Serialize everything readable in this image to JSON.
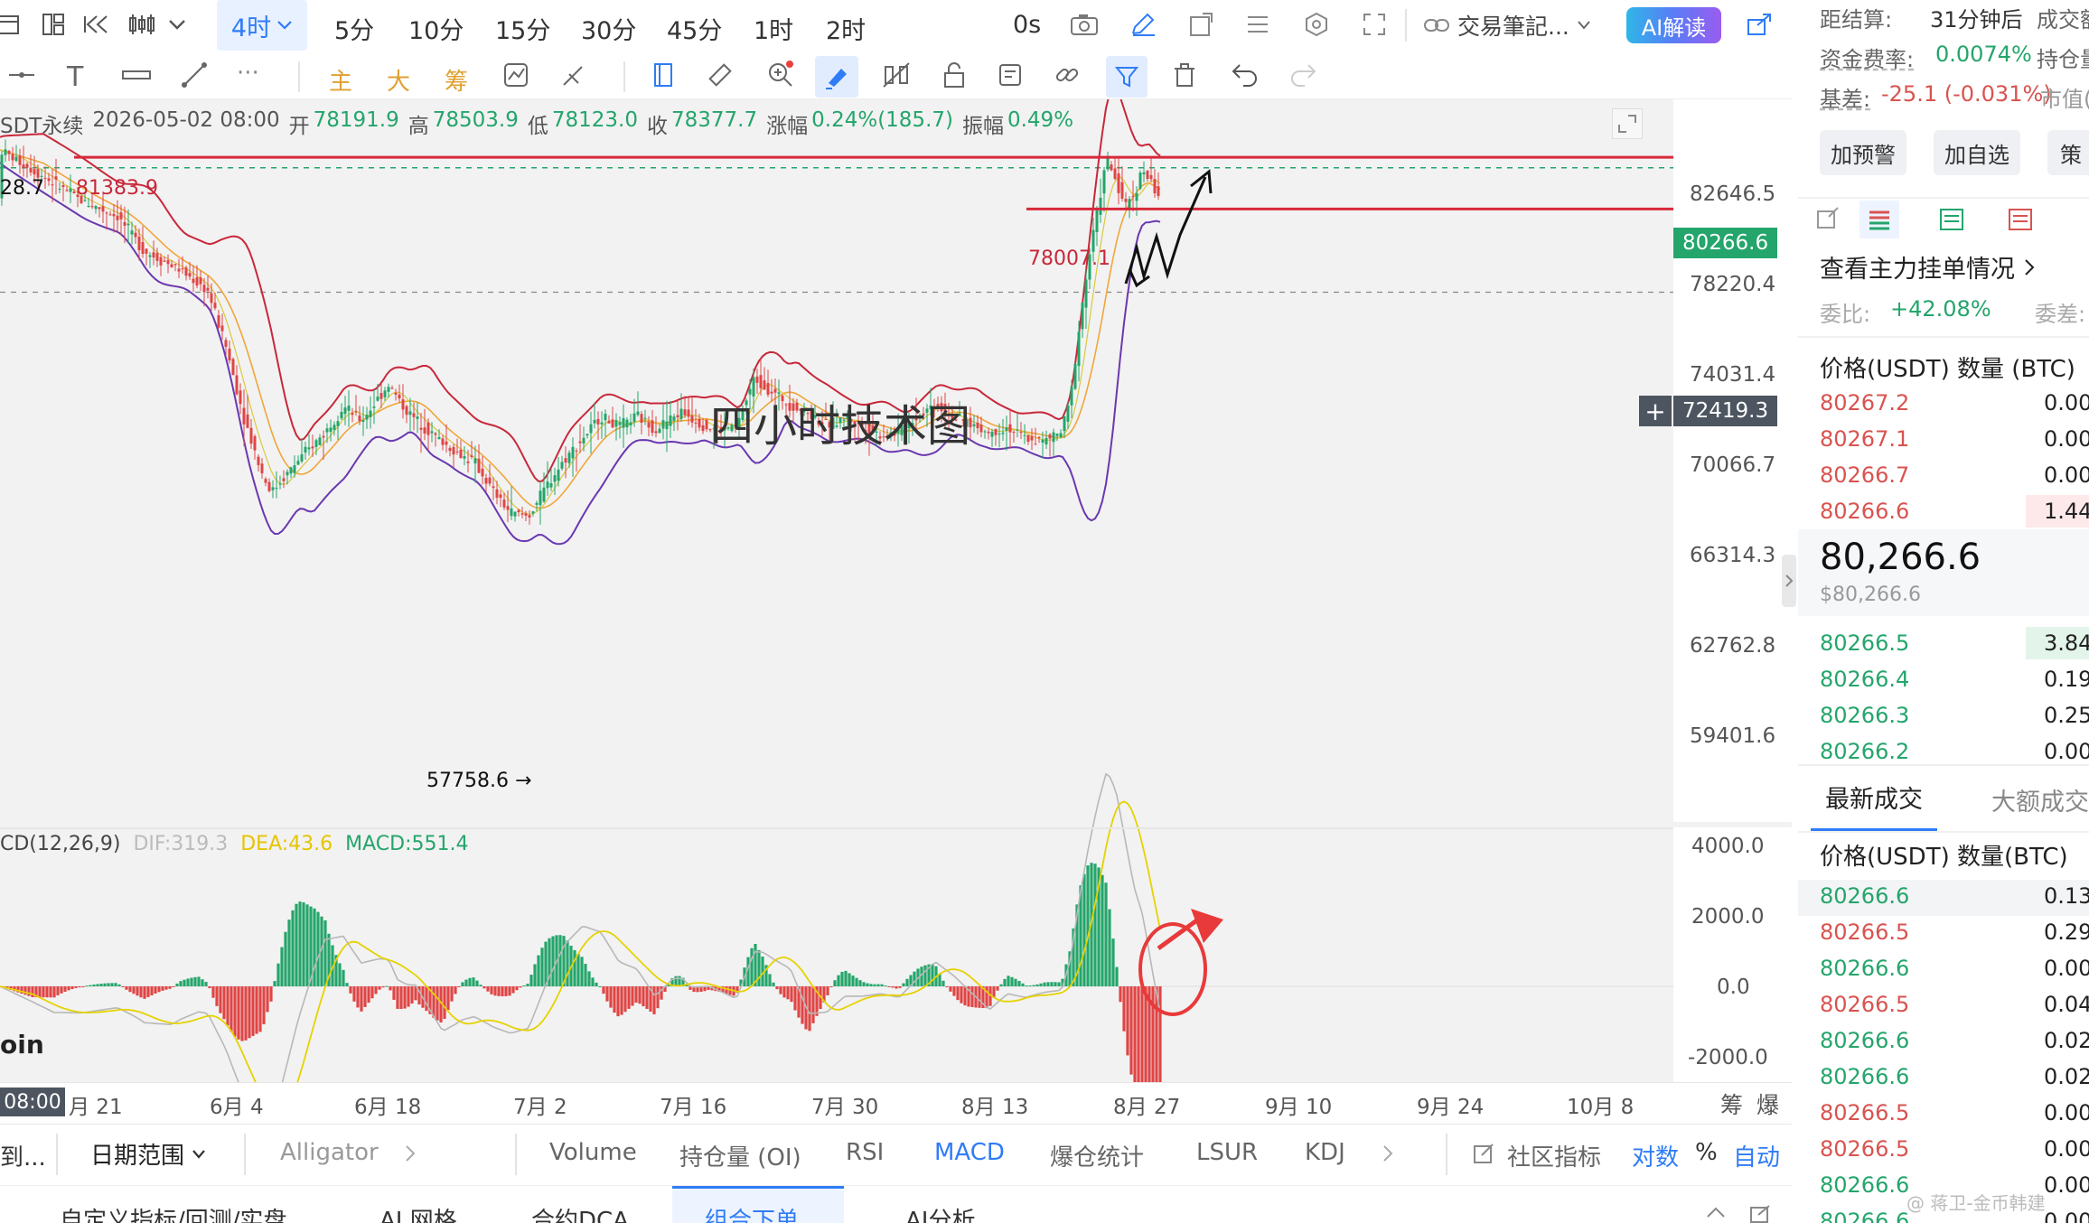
{
  "toolbar": {
    "intervals": [
      "4时",
      "5分",
      "10分",
      "15分",
      "30分",
      "45分",
      "1时",
      "2时"
    ],
    "countdown": "0s",
    "note_dropdown": "交易筆記...",
    "ai_button": "AI解读"
  },
  "drawing_toolbar": {
    "labels": [
      "主",
      "大",
      "筹"
    ]
  },
  "ohlc": {
    "symbol": "SDT永续",
    "datetime": "2026-05-02 08:00",
    "open_label": "开",
    "open": "78191.9",
    "high_label": "高",
    "high": "78503.9",
    "low_label": "低",
    "low": "78123.0",
    "close_label": "收",
    "close": "78377.7",
    "change_label": "涨幅",
    "change": "0.24%(185.7)",
    "amp_label": "振幅",
    "amp": "0.49%"
  },
  "chart": {
    "watermark": "四小时技术图",
    "left_high_label": "28.7",
    "level_high": "81383.9",
    "level_mid": "78007.1",
    "low_label": "57758.6 →",
    "price_axis": [
      "82646.5",
      "78220.4",
      "74031.4",
      "70066.7",
      "66314.3",
      "62762.8",
      "59401.6"
    ],
    "current_price": "80266.6",
    "crosshair_price": "72419.3",
    "date_axis": [
      "月 21",
      "6月 4",
      "6月 18",
      "7月 2",
      "7月 16",
      "7月 30",
      "8月 13",
      "8月 27",
      "9月 10",
      "9月 24",
      "10月 8"
    ],
    "date_cursor": "08:00",
    "axis_right_labels": [
      "筹",
      "爆"
    ],
    "brand_fragment": "oin",
    "colors": {
      "up": "#24a56b",
      "down": "#e04545",
      "level_line": "#d8283a",
      "bb_upper": "#c8283a",
      "bb_lower": "#6a38b0",
      "ma": "#f0a63a",
      "current_pill": "#24a56b",
      "cross_pill": "#4d5560"
    }
  },
  "macd": {
    "title": "CD(12,26,9)",
    "dif": "DIF:319.3",
    "dea": "DEA:43.6",
    "macd": "MACD:551.4",
    "axis": [
      "4000.0",
      "2000.0",
      "0.0",
      "-2000.0"
    ]
  },
  "indicator_bar": {
    "left_cut": "到...",
    "date_range": "日期范围",
    "alligator": "Alligator",
    "items": [
      "Volume",
      "持仓量 (OI)",
      "RSI",
      "MACD",
      "爆仓统计",
      "LSUR",
      "KDJ"
    ],
    "active": "MACD",
    "community": "社区指标",
    "log": "对数",
    "percent": "%",
    "auto": "自动"
  },
  "bottom_tabs": [
    "自定义指标/回测/实盘",
    "AI 网格",
    "合约DCA",
    "组合下单",
    "AI分析"
  ],
  "bottom_active": "组合下单",
  "right": {
    "settle_label": "距结算:",
    "settle_value": "31分钟后",
    "volume_label": "成交额",
    "funding_label": "资金费率:",
    "funding_value": "0.0074%",
    "oi_label": "持仓量",
    "basis_label": "基差:",
    "basis_value": "-25.1 (-0.031%)",
    "mkt_label": "市值(",
    "btn_alert": "加预警",
    "btn_fav": "加自选",
    "btn_more": "策",
    "main_orders": "查看主力挂单情况",
    "ratio_label": "委比:",
    "ratio_value": "+42.08%",
    "diff_label": "委差:",
    "ob_header": "价格(USDT) 数量 (BTC)",
    "asks": [
      {
        "price": "80267.2",
        "qty": "0.00"
      },
      {
        "price": "80267.1",
        "qty": "0.00"
      },
      {
        "price": "80266.7",
        "qty": "0.00"
      },
      {
        "price": "80266.6",
        "qty": "1.44"
      }
    ],
    "last_price": "80,266.6",
    "last_price_usd": "$80,266.6",
    "bids": [
      {
        "price": "80266.5",
        "qty": "3.84"
      },
      {
        "price": "80266.4",
        "qty": "0.19"
      },
      {
        "price": "80266.3",
        "qty": "0.25"
      },
      {
        "price": "80266.2",
        "qty": "0.00"
      }
    ],
    "trades_tab": "最新成交",
    "big_trades_tab": "大额成交",
    "trades_header": "价格(USDT) 数量(BTC)",
    "trades": [
      {
        "price": "80266.6",
        "qty": "0.13",
        "side": "buy"
      },
      {
        "price": "80266.5",
        "qty": "0.29",
        "side": "sell"
      },
      {
        "price": "80266.6",
        "qty": "0.00",
        "side": "buy"
      },
      {
        "price": "80266.5",
        "qty": "0.04",
        "side": "sell"
      },
      {
        "price": "80266.6",
        "qty": "0.02",
        "side": "buy"
      },
      {
        "price": "80266.6",
        "qty": "0.02",
        "side": "buy"
      },
      {
        "price": "80266.5",
        "qty": "0.00",
        "side": "sell"
      },
      {
        "price": "80266.5",
        "qty": "0.00",
        "side": "sell"
      },
      {
        "price": "80266.6",
        "qty": "0.00",
        "side": "buy"
      },
      {
        "price": "80266.6",
        "qty": "0.00",
        "side": "buy"
      }
    ],
    "watermark": "@ 蒋卫-金币韩建"
  }
}
